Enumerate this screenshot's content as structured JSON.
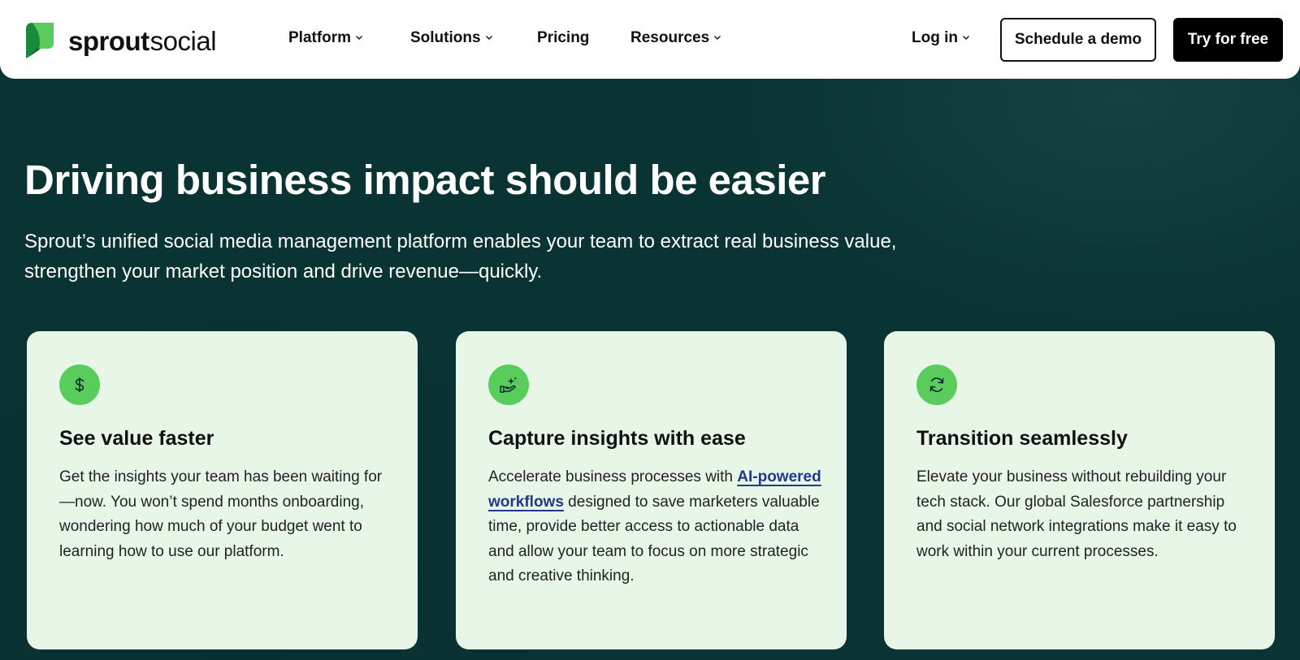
{
  "brand": {
    "name_bold": "sprout",
    "name_regular": "social",
    "colors": {
      "logo_green_dark": "#1a7a3a",
      "logo_green_light": "#59cc5b",
      "background": "#0a3333",
      "card_background": "#e8f6e8",
      "icon_background": "#59cc5b",
      "link": "#1f3a8a"
    }
  },
  "nav": {
    "items": [
      {
        "label": "Platform",
        "has_dropdown": true
      },
      {
        "label": "Solutions",
        "has_dropdown": true
      },
      {
        "label": "Pricing",
        "has_dropdown": false
      },
      {
        "label": "Resources",
        "has_dropdown": true
      }
    ],
    "login_label": "Log in",
    "schedule_demo_label": "Schedule a demo",
    "try_free_label": "Try for free"
  },
  "hero": {
    "title": "Driving business impact should be easier",
    "subtitle": "Sprout’s unified social media management platform enables your team to extract real business value, strengthen your market position and drive revenue—quickly."
  },
  "cards": [
    {
      "icon": "dollar-icon",
      "title": "See value faster",
      "body": "Get the insights your team has been waiting for—now. You won’t spend months onboarding, wondering how much of your budget went to learning how to use our platform."
    },
    {
      "icon": "hand-sparkle-icon",
      "title": "Capture insights with ease",
      "body_before": "Accelerate business processes with ",
      "link_text": "AI-powered workflows",
      "body_after": " designed to save marketers valuable time, provide better access to actionable data and allow your team to focus on more strategic and creative thinking."
    },
    {
      "icon": "refresh-icon",
      "title": "Transition seamlessly",
      "body": "Elevate your business without rebuilding your tech stack. Our global Salesforce partnership and social network integrations make it easy to work within your current processes."
    }
  ]
}
